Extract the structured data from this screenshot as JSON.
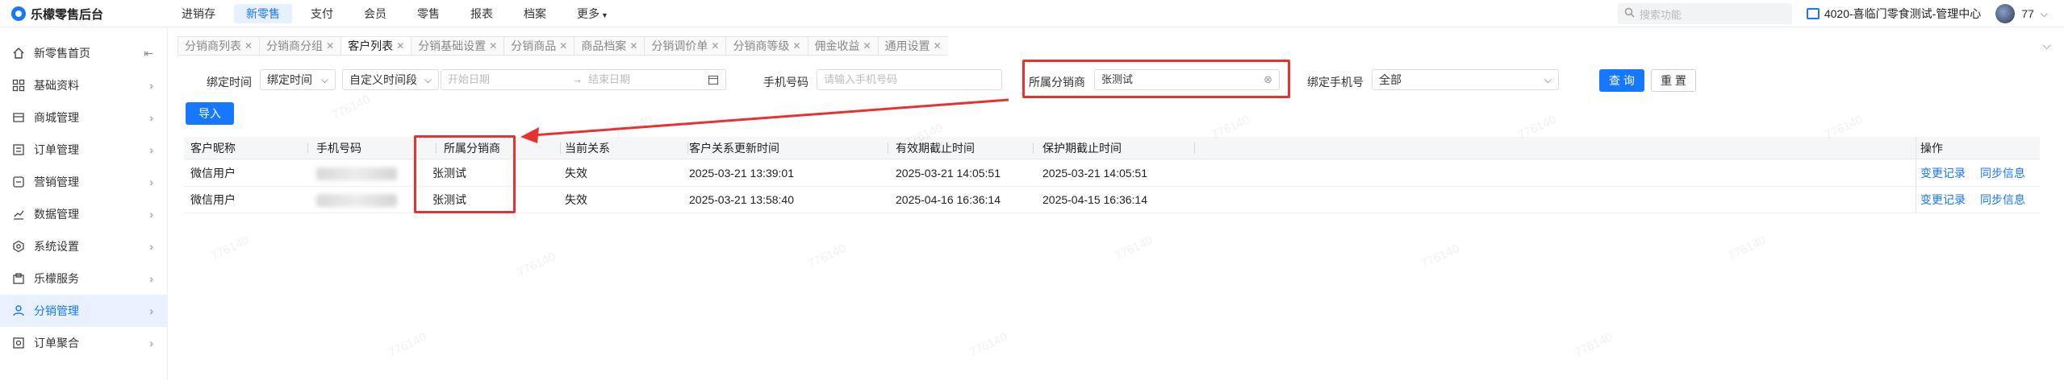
{
  "app": {
    "title": "乐檬零售后台"
  },
  "nav": {
    "items": [
      "进销存",
      "新零售",
      "支付",
      "会员",
      "零售",
      "报表",
      "档案",
      "更多"
    ],
    "active": "新零售"
  },
  "topright": {
    "search_placeholder": "搜索功能",
    "store": "4020-喜临门零食测试-管理中心",
    "user": "77"
  },
  "sidebar": {
    "items": [
      {
        "label": "新零售首页",
        "icon": "home-icon"
      },
      {
        "label": "基础资料",
        "icon": "grid-icon"
      },
      {
        "label": "商城管理",
        "icon": "store-icon"
      },
      {
        "label": "订单管理",
        "icon": "list-icon"
      },
      {
        "label": "营销管理",
        "icon": "marketing-icon"
      },
      {
        "label": "数据管理",
        "icon": "chart-icon"
      },
      {
        "label": "系统设置",
        "icon": "settings-icon"
      },
      {
        "label": "乐檬服务",
        "icon": "service-icon"
      },
      {
        "label": "分销管理",
        "icon": "distribution-icon"
      },
      {
        "label": "订单聚合",
        "icon": "aggregate-icon"
      }
    ],
    "active": "分销管理"
  },
  "tabs": [
    "分销商列表",
    "分销商分组",
    "客户列表",
    "分销基础设置",
    "分销商品",
    "商品档案",
    "分销调价单",
    "分销商等级",
    "佣金收益",
    "通用设置"
  ],
  "active_tab": "客户列表",
  "filters": {
    "bind_time_label": "绑定时间",
    "bind_time_value": "绑定时间",
    "time_range_value": "自定义时间段",
    "start_placeholder": "开始日期",
    "end_placeholder": "结束日期",
    "phone_label": "手机号码",
    "phone_placeholder": "请输入手机号码",
    "distributor_label": "所属分销商",
    "distributor_value": "张测试",
    "bind_phone_label": "绑定手机号",
    "bind_phone_value": "全部",
    "query_label": "查 询",
    "reset_label": "重 置",
    "import_label": "导入"
  },
  "table": {
    "headers": [
      "客户昵称",
      "手机号码",
      "所属分销商",
      "当前关系",
      "客户关系更新时间",
      "有效期截止时间",
      "保护期截止时间",
      "操作"
    ],
    "rows": [
      {
        "nickname": "微信用户",
        "distributor": "张测试",
        "relation": "失效",
        "updated": "2025-03-21 13:39:01",
        "valid_until": "2025-03-21 14:05:51",
        "protect_until": "2025-03-21 14:05:51",
        "op1": "变更记录",
        "op2": "同步信息"
      },
      {
        "nickname": "微信用户",
        "distributor": "张测试",
        "relation": "失效",
        "updated": "2025-03-21 13:58:40",
        "valid_until": "2025-04-16 16:36:14",
        "protect_until": "2025-04-15 16:36:14",
        "op1": "变更记录",
        "op2": "同步信息"
      }
    ]
  },
  "colors": {
    "accent": "#1677ff",
    "annotation": "#e8322f"
  }
}
